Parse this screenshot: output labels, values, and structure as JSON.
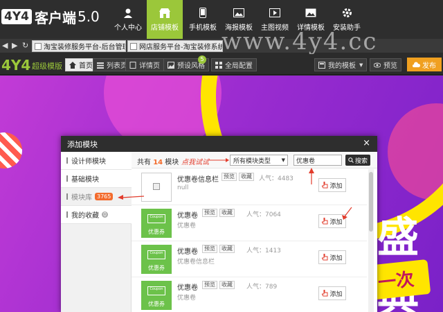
{
  "app": {
    "logo_box": "4Y4",
    "logo_text": "客户端",
    "logo_version": "5.0"
  },
  "nav": [
    {
      "label": "个人中心",
      "icon": "user-icon"
    },
    {
      "label": "店铺模板",
      "icon": "store-icon",
      "active": true
    },
    {
      "label": "手机模板",
      "icon": "phone-icon"
    },
    {
      "label": "海报模板",
      "icon": "poster-icon"
    },
    {
      "label": "主图视频",
      "icon": "video-icon"
    },
    {
      "label": "详情模板",
      "icon": "image-icon"
    },
    {
      "label": "安装助手",
      "icon": "gear-icon"
    }
  ],
  "tabs": [
    {
      "label": "淘宝装修服务平台-后台管理"
    },
    {
      "label": "网店服务平台-淘宝装修系统"
    }
  ],
  "watermark": "www.4y4.cc",
  "toolbar": {
    "brand": "4Y4",
    "brand_sub": "超级模版",
    "home": "首页",
    "list_page": "列表页",
    "detail_page": "详情页",
    "preset_style": "预设风格",
    "preset_badge": "5",
    "global_config": "全局配置",
    "my_templates": "我的模板",
    "preview": "预览",
    "publish": "发布"
  },
  "modal": {
    "title": "添加模块",
    "close": "×",
    "sidebar": [
      {
        "label": "设计师模块"
      },
      {
        "label": "基础模块"
      },
      {
        "label": "模块库",
        "badge": "3765",
        "active": true
      },
      {
        "label": "我的收藏",
        "count": "0"
      }
    ],
    "filter": {
      "total_prefix": "共有",
      "total_num": "14",
      "total_suffix": "模块",
      "hint": "点我试试",
      "type_select": "所有模块类型",
      "search_value": "优惠卷",
      "search_button": "搜索"
    },
    "rows": [
      {
        "title": "优惠卷信息栏",
        "tag1": "预览",
        "tag2": "收藏",
        "popularity": "人气：4483",
        "desc": "null",
        "thumb": "blank",
        "add": "添加"
      },
      {
        "title": "优惠卷",
        "tag1": "预览",
        "tag2": "收藏",
        "popularity": "人气：7064",
        "desc": "优惠卷",
        "thumb": "green",
        "thumb_caption": "优惠券",
        "add": "添加"
      },
      {
        "title": "优惠卷",
        "tag1": "预览",
        "tag2": "收藏",
        "popularity": "人气：1413",
        "desc": "优惠卷信息栏",
        "thumb": "green",
        "thumb_caption": "优惠券",
        "add": "添加"
      },
      {
        "title": "优惠卷",
        "tag1": "预览",
        "tag2": "收藏",
        "popularity": "人气：789",
        "desc": "优惠卷",
        "thumb": "green",
        "thumb_caption": "优惠券",
        "add": "添加"
      }
    ],
    "coupon_thumb_text": "Coupon"
  },
  "canvas": {
    "big_text": "盛典",
    "yellow_text": "一次"
  },
  "colors": {
    "accent_green": "#9bc73a",
    "badge_orange": "#f36b2c",
    "publish_orange": "#f0a020",
    "annotation_red": "#e23c2c"
  }
}
